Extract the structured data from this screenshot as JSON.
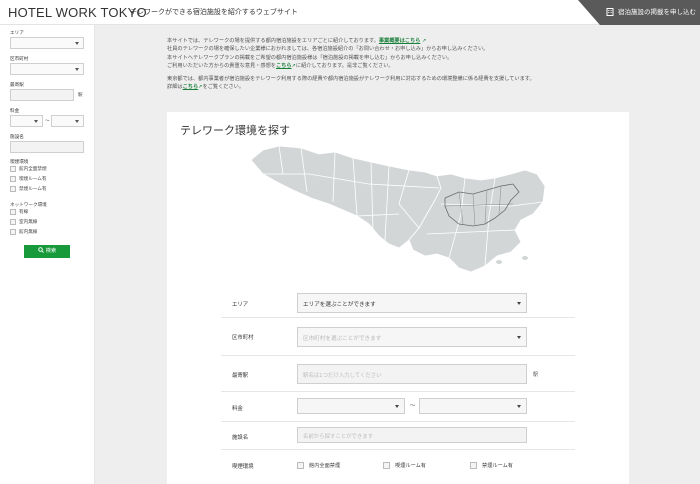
{
  "header": {
    "logo": "HOTEL WORK TOKYO",
    "tagline": "テレワークができる宿泊施設を紹介するウェブサイト",
    "cta_label": "宿泊施設の掲載を申し込む"
  },
  "sidebar": {
    "area_label": "エリア",
    "city_label": "区市町村",
    "station_label": "最寄駅",
    "station_suffix": "駅",
    "price_label": "料金",
    "price_sep": "〜",
    "facility_label": "施設名",
    "env_label": "喫煙環境",
    "env_options": [
      "館内全面禁煙",
      "喫煙ルーム有",
      "禁煙ルーム有"
    ],
    "net_label": "ネットワーク環境",
    "net_options": [
      "有線",
      "室内無線",
      "館内無線"
    ],
    "search_label": "検索"
  },
  "intro": {
    "line1_pre": "本サイトでは、テレワークの場を提供する都内宿泊施設をエリアごとに紹介しております。",
    "line1_link": "事業概要はこちら",
    "line2": "社員のテレワークの場を確保したい企業様におかれましては、各宿泊施設紹介の「お問い合わせ・お申し込み」からお申し込みください。",
    "line3": "本サイトへテレワークプランの掲載をご希望の都内宿泊施設様は「宿泊施設の掲載を申し込む」からお申し込みください。",
    "line4_pre": "ご利用いただいた方からの貴重な意見・感想を",
    "line4_link": "こちら",
    "line4_post": "に紹介しております。是非ご覧ください。",
    "line5": "東京都では、都内事業者が宿泊施設をテレワーク利用する際の経費や都内宿泊施設がテレワーク利用に対応するための環境整備に係る経費を支援しています。",
    "line6_pre": "詳細は",
    "line6_link": "こちら",
    "line6_post": "をご覧ください。"
  },
  "search": {
    "title": "テレワーク環境を探す",
    "area_label": "エリア",
    "area_value": "エリアを選ぶことができます",
    "city_label": "区市町村",
    "city_placeholder": "区市町村を選ぶことができます",
    "station_label": "最寄駅",
    "station_placeholder": "駅名は1つだけ入力してください",
    "station_suffix": "駅",
    "price_label": "料金",
    "price_sep": "〜",
    "facility_label": "施設名",
    "facility_placeholder": "名前から探すことができます",
    "env_label": "喫煙環境",
    "env_options": [
      "館内全面禁煙",
      "喫煙ルーム有",
      "禁煙ルーム有"
    ]
  },
  "colors": {
    "accent": "#189a3b",
    "header_cta": "#5a5a5a",
    "map": "#d3d6d7"
  }
}
